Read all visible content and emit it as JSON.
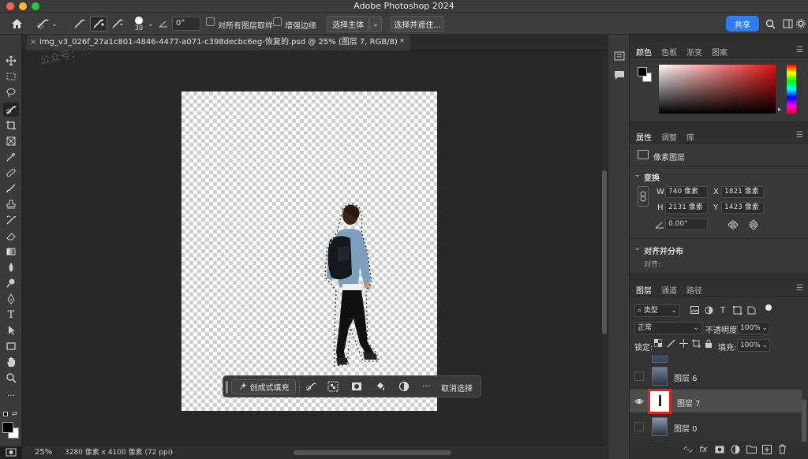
{
  "window": {
    "title": "Adobe Photoshop 2024"
  },
  "options_bar": {
    "brush_size": "30",
    "angle_value": "0°",
    "sample_all_layers_label": "对所有图层取样",
    "enhance_edge_label": "增强边缘",
    "select_subject_label": "选择主体",
    "select_and_mask_label": "选择并遮住...",
    "share_label": "共享"
  },
  "document": {
    "tab_title": "img_v3_026f_27a1c801-4846-4477-a071-c398decbc6eg-恢复的.psd @ 25% (图层 7, RGB/8) *",
    "close_glyph": "×",
    "watermark": "公众号：..."
  },
  "contextual_bar": {
    "generative_fill_label": "创成式填充",
    "more_glyph": "···",
    "deselect_label": "取消选择"
  },
  "status_bar": {
    "zoom": "25%",
    "doc_info": "3280 像素 x 4100 像素 (72 ppi)",
    "arrow": "›"
  },
  "color_panel": {
    "tabs": [
      "颜色",
      "色板",
      "渐变",
      "图案"
    ],
    "foreground": "#000000",
    "background": "#ffffff",
    "hue": "#e01010"
  },
  "properties_panel": {
    "tabs": [
      "属性",
      "调整",
      "库"
    ],
    "layer_type": "像素图层",
    "transform_title": "变换",
    "w_label": "W",
    "w_value": "740 像素",
    "x_label": "X",
    "x_value": "1821 像素",
    "h_label": "H",
    "h_value": "2131 像素",
    "y_label": "Y",
    "y_value": "1423 像素",
    "angle_value": "0.00°",
    "align_title": "对齐并分布",
    "align_sub": "对齐:"
  },
  "layers_panel": {
    "tabs": [
      "图层",
      "通道",
      "路径"
    ],
    "filter_label": "类型",
    "blend_mode": "正常",
    "opacity_label": "不透明度:",
    "opacity_value": "100%",
    "lock_label": "锁定:",
    "fill_label": "填充:",
    "fill_value": "100%",
    "layers": [
      {
        "name": "图层 6",
        "visible": false,
        "selected": false
      },
      {
        "name": "图层 7",
        "visible": true,
        "selected": true
      },
      {
        "name": "图层 0",
        "visible": false,
        "selected": false
      }
    ],
    "highlight_color": "#e0241c"
  },
  "colors": {
    "accent": "#2f7bf0"
  }
}
